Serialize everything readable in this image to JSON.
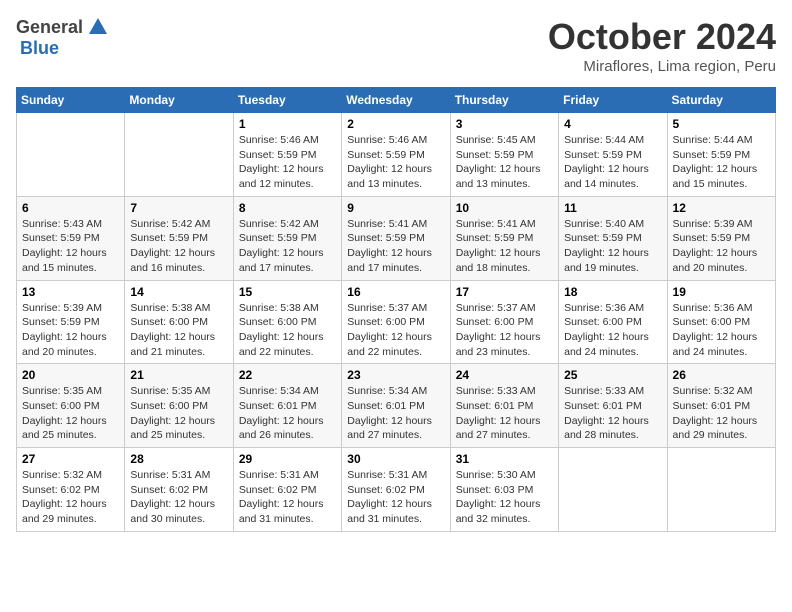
{
  "logo": {
    "general": "General",
    "blue": "Blue"
  },
  "title": "October 2024",
  "subtitle": "Miraflores, Lima region, Peru",
  "days_header": [
    "Sunday",
    "Monday",
    "Tuesday",
    "Wednesday",
    "Thursday",
    "Friday",
    "Saturday"
  ],
  "weeks": [
    [
      {
        "num": "",
        "info": ""
      },
      {
        "num": "",
        "info": ""
      },
      {
        "num": "1",
        "info": "Sunrise: 5:46 AM\nSunset: 5:59 PM\nDaylight: 12 hours and 12 minutes."
      },
      {
        "num": "2",
        "info": "Sunrise: 5:46 AM\nSunset: 5:59 PM\nDaylight: 12 hours and 13 minutes."
      },
      {
        "num": "3",
        "info": "Sunrise: 5:45 AM\nSunset: 5:59 PM\nDaylight: 12 hours and 13 minutes."
      },
      {
        "num": "4",
        "info": "Sunrise: 5:44 AM\nSunset: 5:59 PM\nDaylight: 12 hours and 14 minutes."
      },
      {
        "num": "5",
        "info": "Sunrise: 5:44 AM\nSunset: 5:59 PM\nDaylight: 12 hours and 15 minutes."
      }
    ],
    [
      {
        "num": "6",
        "info": "Sunrise: 5:43 AM\nSunset: 5:59 PM\nDaylight: 12 hours and 15 minutes."
      },
      {
        "num": "7",
        "info": "Sunrise: 5:42 AM\nSunset: 5:59 PM\nDaylight: 12 hours and 16 minutes."
      },
      {
        "num": "8",
        "info": "Sunrise: 5:42 AM\nSunset: 5:59 PM\nDaylight: 12 hours and 17 minutes."
      },
      {
        "num": "9",
        "info": "Sunrise: 5:41 AM\nSunset: 5:59 PM\nDaylight: 12 hours and 17 minutes."
      },
      {
        "num": "10",
        "info": "Sunrise: 5:41 AM\nSunset: 5:59 PM\nDaylight: 12 hours and 18 minutes."
      },
      {
        "num": "11",
        "info": "Sunrise: 5:40 AM\nSunset: 5:59 PM\nDaylight: 12 hours and 19 minutes."
      },
      {
        "num": "12",
        "info": "Sunrise: 5:39 AM\nSunset: 5:59 PM\nDaylight: 12 hours and 20 minutes."
      }
    ],
    [
      {
        "num": "13",
        "info": "Sunrise: 5:39 AM\nSunset: 5:59 PM\nDaylight: 12 hours and 20 minutes."
      },
      {
        "num": "14",
        "info": "Sunrise: 5:38 AM\nSunset: 6:00 PM\nDaylight: 12 hours and 21 minutes."
      },
      {
        "num": "15",
        "info": "Sunrise: 5:38 AM\nSunset: 6:00 PM\nDaylight: 12 hours and 22 minutes."
      },
      {
        "num": "16",
        "info": "Sunrise: 5:37 AM\nSunset: 6:00 PM\nDaylight: 12 hours and 22 minutes."
      },
      {
        "num": "17",
        "info": "Sunrise: 5:37 AM\nSunset: 6:00 PM\nDaylight: 12 hours and 23 minutes."
      },
      {
        "num": "18",
        "info": "Sunrise: 5:36 AM\nSunset: 6:00 PM\nDaylight: 12 hours and 24 minutes."
      },
      {
        "num": "19",
        "info": "Sunrise: 5:36 AM\nSunset: 6:00 PM\nDaylight: 12 hours and 24 minutes."
      }
    ],
    [
      {
        "num": "20",
        "info": "Sunrise: 5:35 AM\nSunset: 6:00 PM\nDaylight: 12 hours and 25 minutes."
      },
      {
        "num": "21",
        "info": "Sunrise: 5:35 AM\nSunset: 6:00 PM\nDaylight: 12 hours and 25 minutes."
      },
      {
        "num": "22",
        "info": "Sunrise: 5:34 AM\nSunset: 6:01 PM\nDaylight: 12 hours and 26 minutes."
      },
      {
        "num": "23",
        "info": "Sunrise: 5:34 AM\nSunset: 6:01 PM\nDaylight: 12 hours and 27 minutes."
      },
      {
        "num": "24",
        "info": "Sunrise: 5:33 AM\nSunset: 6:01 PM\nDaylight: 12 hours and 27 minutes."
      },
      {
        "num": "25",
        "info": "Sunrise: 5:33 AM\nSunset: 6:01 PM\nDaylight: 12 hours and 28 minutes."
      },
      {
        "num": "26",
        "info": "Sunrise: 5:32 AM\nSunset: 6:01 PM\nDaylight: 12 hours and 29 minutes."
      }
    ],
    [
      {
        "num": "27",
        "info": "Sunrise: 5:32 AM\nSunset: 6:02 PM\nDaylight: 12 hours and 29 minutes."
      },
      {
        "num": "28",
        "info": "Sunrise: 5:31 AM\nSunset: 6:02 PM\nDaylight: 12 hours and 30 minutes."
      },
      {
        "num": "29",
        "info": "Sunrise: 5:31 AM\nSunset: 6:02 PM\nDaylight: 12 hours and 31 minutes."
      },
      {
        "num": "30",
        "info": "Sunrise: 5:31 AM\nSunset: 6:02 PM\nDaylight: 12 hours and 31 minutes."
      },
      {
        "num": "31",
        "info": "Sunrise: 5:30 AM\nSunset: 6:03 PM\nDaylight: 12 hours and 32 minutes."
      },
      {
        "num": "",
        "info": ""
      },
      {
        "num": "",
        "info": ""
      }
    ]
  ]
}
